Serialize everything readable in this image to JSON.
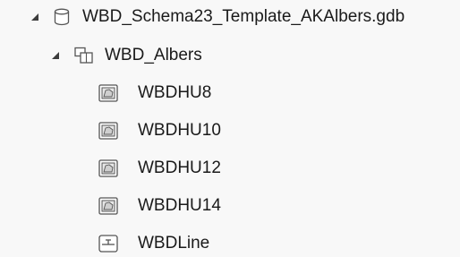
{
  "tree": {
    "root": {
      "label": "WBD_Schema23_Template_AKAlbers.gdb",
      "icon": "database-icon",
      "expanded": true
    },
    "dataset": {
      "label": "WBD_Albers",
      "icon": "feature-dataset-icon",
      "expanded": true
    },
    "items": [
      {
        "label": "WBDHU8",
        "icon": "polygon-feature-class-icon"
      },
      {
        "label": "WBDHU10",
        "icon": "polygon-feature-class-icon"
      },
      {
        "label": "WBDHU12",
        "icon": "polygon-feature-class-icon"
      },
      {
        "label": "WBDHU14",
        "icon": "polygon-feature-class-icon"
      },
      {
        "label": "WBDLine",
        "icon": "line-feature-class-icon"
      }
    ]
  },
  "colors": {
    "background": "#f8f8f8",
    "text": "#1a1a1a",
    "icon_stroke": "#555555",
    "icon_fill": "#e6e6e6"
  }
}
